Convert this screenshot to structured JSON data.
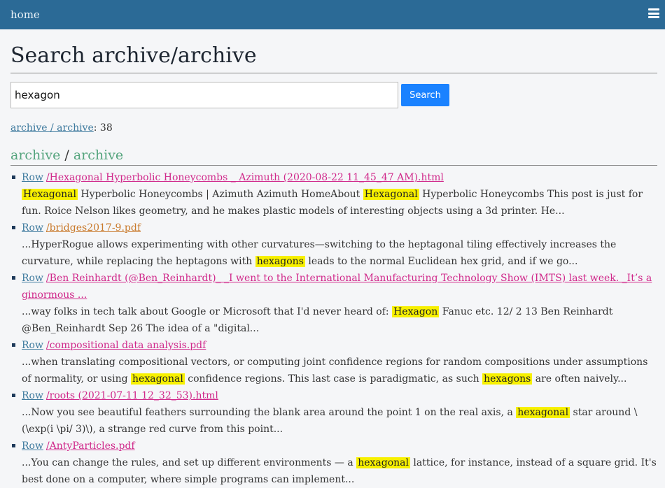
{
  "nav": {
    "home_label": "home",
    "menu_icon": "hamburger-icon"
  },
  "page": {
    "title": "Search archive/archive"
  },
  "search": {
    "value": "hexagon",
    "button_label": "Search"
  },
  "count": {
    "link_text": "archive / archive",
    "suffix": ": 38"
  },
  "section": {
    "part1": "archive",
    "sep": " / ",
    "part2": "archive"
  },
  "results": [
    {
      "row_label": "Row",
      "file": "/Hexagonal Hyperbolic Honeycombs _ Azimuth (2020-08-22 11_45_47 AM).html",
      "file_type": "html",
      "snippet": [
        {
          "t": "Hexagonal",
          "h": true
        },
        {
          "t": " Hyperbolic Honeycombs | Azimuth Azimuth HomeAbout   ",
          "h": false
        },
        {
          "t": "Hexagonal",
          "h": true
        },
        {
          "t": " Hyperbolic Honeycombs This post is just for fun. Roice Nelson likes geometry, and he makes plastic models of interesting objects using a 3d printer. He...",
          "h": false
        }
      ]
    },
    {
      "row_label": "Row",
      "file": "/bridges2017-9.pdf",
      "file_type": "pdf",
      "snippet": [
        {
          "t": "...HyperRogue allows experimenting with other curvatures—switching to the heptagonal tiling effectively increases the curvature, while replacing the heptagons with ",
          "h": false
        },
        {
          "t": "hexagons",
          "h": true
        },
        {
          "t": " leads to the normal Euclidean hex grid, and if we go...",
          "h": false
        }
      ]
    },
    {
      "row_label": "Row",
      "file": "/Ben Reinhardt (@Ben_Reinhardt)_ _I went to the International Manufacturing Technology Show (IMTS) last week. _It’s a ginormous ...",
      "file_type": "html",
      "snippet": [
        {
          "t": "...way folks in tech talk about Google or Microsoft that I'd never heard of: ",
          "h": false
        },
        {
          "t": "Hexagon",
          "h": true
        },
        {
          "t": " Fanuc etc. 12/ 2 13 Ben Reinhardt @Ben_Reinhardt Sep 26 The idea of a \"digital...",
          "h": false
        }
      ]
    },
    {
      "row_label": "Row",
      "file": "/compositional data analysis.pdf",
      "file_type": "html",
      "snippet": [
        {
          "t": "...when translating compositional vectors, or computing joint confidence regions for random compositions under assumptions of normality, or using ",
          "h": false
        },
        {
          "t": "hexagonal",
          "h": true
        },
        {
          "t": " confidence regions. This last case is paradigmatic, as such ",
          "h": false
        },
        {
          "t": "hexagons",
          "h": true
        },
        {
          "t": " are often naively...",
          "h": false
        }
      ]
    },
    {
      "row_label": "Row",
      "file": "/roots (2021-07-11 12_32_53).html",
      "file_type": "html",
      "snippet": [
        {
          "t": "...Now you see beautiful feathers surrounding the blank area around the point 1 on the real axis, a ",
          "h": false
        },
        {
          "t": "hexagonal",
          "h": true
        },
        {
          "t": " star around \\(\\exp(i \\pi/ 3)\\), a strange red curve from this point...",
          "h": false
        }
      ]
    },
    {
      "row_label": "Row",
      "file": "/AntyParticles.pdf",
      "file_type": "html",
      "snippet": [
        {
          "t": "...You can change the rules, and set up different environments — a ",
          "h": false
        },
        {
          "t": "hexagonal",
          "h": true
        },
        {
          "t": " lattice, for instance, instead of a square grid. It's best done on a computer, where simple programs can implement...",
          "h": false
        }
      ]
    }
  ]
}
